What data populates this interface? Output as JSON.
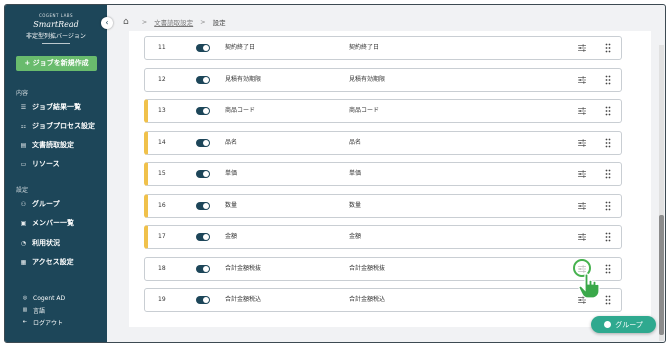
{
  "sidebar": {
    "brand_small": "COGENT LABS",
    "brand_name": "SmartRead",
    "brand_subtitle": "非定型列拡バージョン",
    "new_job_label": "+ ジョブを新規作成",
    "section_content": "内容",
    "content_items": [
      {
        "label": "ジョブ結果一覧",
        "icon": "list-icon"
      },
      {
        "label": "ジョブプロセス設定",
        "icon": "process-icon"
      },
      {
        "label": "文書読取設定",
        "icon": "document-icon"
      },
      {
        "label": "リソース",
        "icon": "resource-icon"
      }
    ],
    "section_settings": "設定",
    "settings_items": [
      {
        "label": "グループ",
        "icon": "group-icon"
      },
      {
        "label": "メンバー一覧",
        "icon": "member-icon"
      },
      {
        "label": "利用状況",
        "icon": "usage-icon"
      },
      {
        "label": "アクセス設定",
        "icon": "access-icon"
      }
    ],
    "footer_items": [
      {
        "label": "Cogent AD",
        "icon": "user-icon"
      },
      {
        "label": "言語",
        "icon": "language-icon"
      },
      {
        "label": "ログアウト",
        "icon": "logout-icon"
      }
    ]
  },
  "breadcrumb": {
    "link": "文書読取設定",
    "current": "設定"
  },
  "rows": [
    {
      "num": "11",
      "name": "契約終了日",
      "mapped": "契約終了日",
      "marked": false
    },
    {
      "num": "12",
      "name": "見積有効期限",
      "mapped": "見積有効期限",
      "marked": false
    },
    {
      "num": "13",
      "name": "商品コード",
      "mapped": "商品コード",
      "marked": true
    },
    {
      "num": "14",
      "name": "品名",
      "mapped": "品名",
      "marked": true
    },
    {
      "num": "15",
      "name": "単価",
      "mapped": "単価",
      "marked": true
    },
    {
      "num": "16",
      "name": "数量",
      "mapped": "数量",
      "marked": true
    },
    {
      "num": "17",
      "name": "金額",
      "mapped": "金額",
      "marked": true
    },
    {
      "num": "18",
      "name": "合計金額税抜",
      "mapped": "合計金額税抜",
      "marked": false
    },
    {
      "num": "19",
      "name": "合計金額税込",
      "mapped": "合計金額税込",
      "marked": false
    }
  ],
  "group_button": "グループ",
  "colors": {
    "sidebar": "#1d4659",
    "new_job": "#69bb6d",
    "marker": "#f0c14b",
    "toggle_on": "#1d4659",
    "group_button": "#2fa98f",
    "highlight_ring": "#46b24e"
  }
}
